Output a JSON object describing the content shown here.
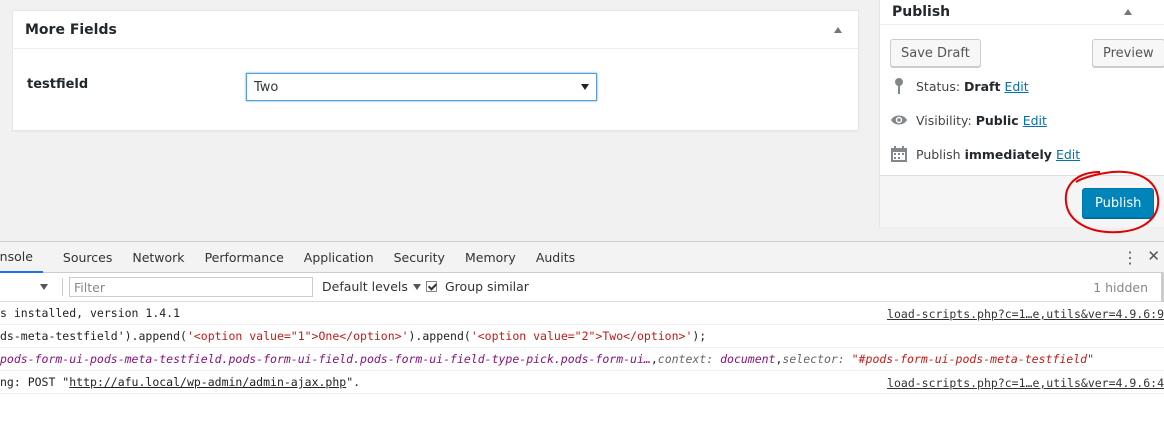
{
  "more_fields": {
    "title": "More Fields",
    "field_label": "testfield",
    "select_value": "Two"
  },
  "publish": {
    "title": "Publish",
    "save_draft": "Save Draft",
    "preview": "Preview",
    "status_label": "Status:",
    "status_value": "Draft",
    "visibility_label": "Visibility:",
    "visibility_value": "Public",
    "publish_label": "Publish",
    "publish_value": "immediately",
    "edit": "Edit",
    "publish_button": "Publish"
  },
  "devtools": {
    "tabs": [
      "onsole",
      "Sources",
      "Network",
      "Performance",
      "Application",
      "Security",
      "Memory",
      "Audits"
    ],
    "filter_placeholder": "Filter",
    "levels": "Default levels",
    "group_similar": "Group similar",
    "hidden": "1 hidden",
    "log": [
      {
        "text": "s installed, version 1.4.1",
        "source": "load-scripts.php?c=1…e,utils&ver=4.9.6:9"
      },
      {
        "prefix": "ds-meta-testfield').append(",
        "s1": "'<option value=\"1\">One</option>'",
        "mid": ").append(",
        "s2": "'<option value=\"2\">Two</option>'",
        "suffix": ");"
      },
      {
        "sel": "pods-form-ui-pods-meta-testfield.pods-form-ui-field.pods-form-ui-field-type-pick.pods-form-ui…",
        "ctx_key": "context:",
        "ctx_val": "document",
        "selk": "selector:",
        "selv": "\"#pods-form-ui-pods-meta-testfield\""
      },
      {
        "pre": "ng: POST \"",
        "url": "http://afu.local/wp-admin/admin-ajax.php",
        "post": "\".",
        "source": "load-scripts.php?c=1…e,utils&ver=4.9.6:4"
      }
    ]
  },
  "colors": {
    "primary": "#0085ba",
    "link": "#0073aa",
    "annotation": "#e00000"
  }
}
